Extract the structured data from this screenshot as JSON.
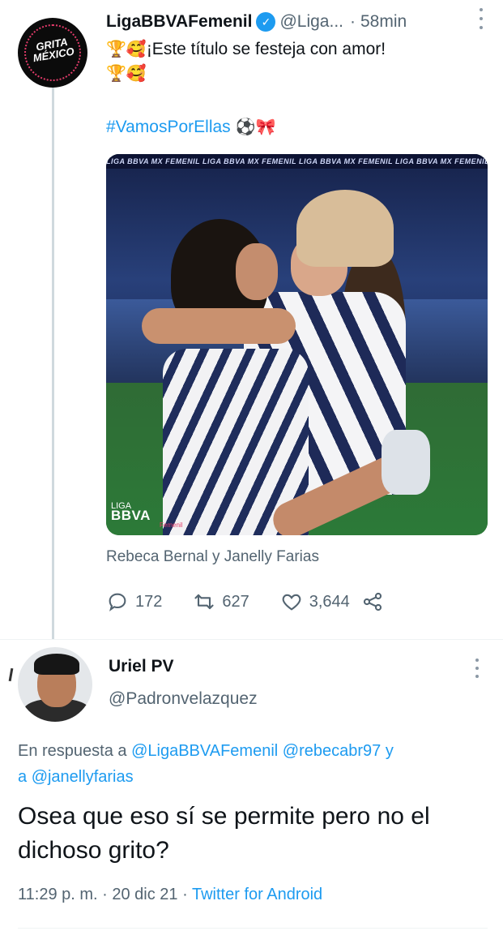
{
  "tweet": {
    "display_name": "LigaBBVAFemenil",
    "handle": "@Liga...",
    "separator": "·",
    "time": "58min",
    "text": "¡Este título se festeja con amor!",
    "emojis_line1": [
      "trophy",
      "smiling-face-with-hearts"
    ],
    "emojis_line2": [
      "trophy",
      "smiling-face-with-hearts"
    ],
    "hashtag": "#VamosPorEllas",
    "hashtag_emojis": [
      "soccer-ball",
      "ribbon"
    ],
    "avatar_text": "GRITA MÉXICO",
    "media": {
      "banner_text": "LIGA BBVA MX FEMENIL  LIGA BBVA MX FEMENIL  LIGA BBVA MX FEMENIL  LIGA BBVA MX FEMENIL",
      "logo_top": "LIGA",
      "logo_main": "BBVA",
      "logo_sub": "Femenil"
    },
    "caption": "Rebeca Bernal y Janelly Farias",
    "actions": {
      "replies": "172",
      "retweets": "627",
      "likes": "3,644"
    }
  },
  "reply": {
    "display_name": "Uriel PV",
    "handle": "@Padronvelazquez",
    "replying_prefix": "En respuesta a",
    "mention1": "@LigaBBVAFemenil",
    "mention2": "@rebecabr97",
    "and_word": "y",
    "a_word": "a",
    "mention3": "@janellyfarias",
    "text": "Osea que eso sí se permite pero no el dichoso grito?",
    "time": "11:29 p. m.",
    "dot1": "·",
    "date": "20 dic 21",
    "dot2": "·",
    "source": "Twitter for Android"
  },
  "colors": {
    "link": "#1d9bf0",
    "secondary_text": "#536471",
    "primary_text": "#0f1419",
    "verified": "#1d9bf0"
  }
}
